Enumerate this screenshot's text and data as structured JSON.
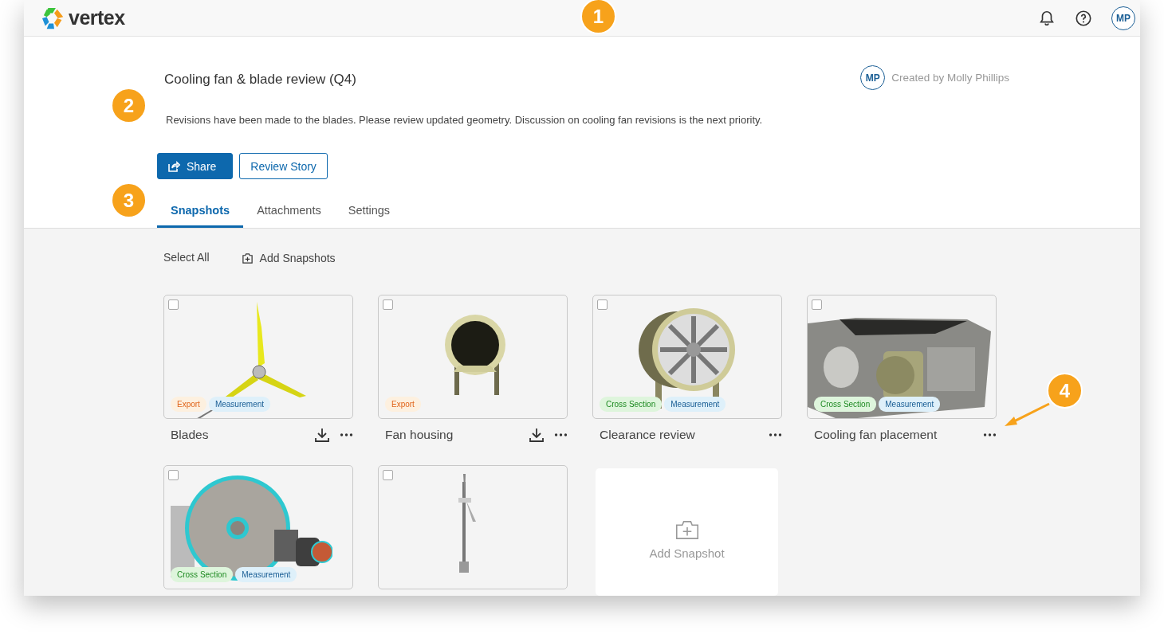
{
  "header": {
    "logo": "vertex",
    "avatar": "MP"
  },
  "story": {
    "title": "Cooling fan & blade review (Q4)",
    "creator_avatar": "MP",
    "creator": "Created by Molly Phillips",
    "description": "Revisions have been made to the blades. Please review updated geometry. Discussion on cooling fan revisions is the next priority."
  },
  "buttons": [
    {
      "label": "Share",
      "kind": "primary"
    },
    {
      "label": "Review Story",
      "kind": "outline"
    }
  ],
  "tabs": [
    {
      "label": "Snapshots",
      "selected": true
    },
    {
      "label": "Attachments",
      "selected": false
    },
    {
      "label": "Settings",
      "selected": false
    }
  ],
  "toolbar": {
    "select_all": "Select All",
    "add_snapshots": "Add Snapshots"
  },
  "snapshots": [
    {
      "name": "Blades",
      "checked": false,
      "download": true,
      "tags": [
        {
          "label": "Export",
          "kind": "export"
        },
        {
          "label": "Measurement",
          "kind": "measurement"
        }
      ]
    },
    {
      "name": "Fan housing",
      "checked": false,
      "download": true,
      "tags": [
        {
          "label": "Export",
          "kind": "export"
        }
      ]
    },
    {
      "name": "Clearance review",
      "checked": false,
      "download": false,
      "tags": [
        {
          "label": "Cross Section",
          "kind": "section"
        },
        {
          "label": "Measurement",
          "kind": "measurement"
        }
      ]
    },
    {
      "name": "Cooling fan placement",
      "checked": false,
      "download": false,
      "tags": [
        {
          "label": "Cross Section",
          "kind": "section"
        },
        {
          "label": "Measurement",
          "kind": "measurement"
        }
      ]
    },
    {
      "checked": false,
      "tags": [
        {
          "label": "Cross Section",
          "kind": "section"
        },
        {
          "label": "Measurement",
          "kind": "measurement"
        }
      ]
    },
    {
      "checked": false
    }
  ],
  "add_tile": {
    "label": "Add Snapshot"
  },
  "callouts": [
    "1",
    "2",
    "3",
    "4"
  ]
}
